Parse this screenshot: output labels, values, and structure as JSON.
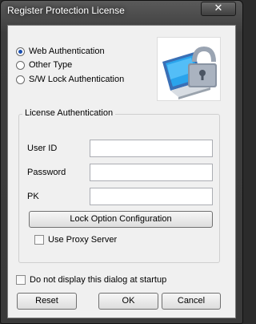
{
  "window": {
    "title": "Register Protection License",
    "close_glyph": "✕"
  },
  "options": [
    {
      "label": "Web Authentication",
      "selected": true
    },
    {
      "label": "Other Type",
      "selected": false
    },
    {
      "label": "S/W Lock Authentication",
      "selected": false
    }
  ],
  "logo": {
    "icon": "computer-padlock-icon",
    "accent": "#1a76d2"
  },
  "license": {
    "group_title": "License Authentication",
    "user_id_label": "User ID",
    "user_id_value": "",
    "password_label": "Password",
    "password_value": "",
    "pk_label": "PK",
    "pk_value": "",
    "lock_option_button": "Lock Option Configuration",
    "use_proxy_label": "Use Proxy Server",
    "use_proxy_checked": false
  },
  "footer": {
    "startup_checkbox_label": "Do not display this dialog at startup",
    "startup_checked": false,
    "reset_button": "Reset",
    "ok_button": "OK",
    "cancel_button": "Cancel"
  }
}
